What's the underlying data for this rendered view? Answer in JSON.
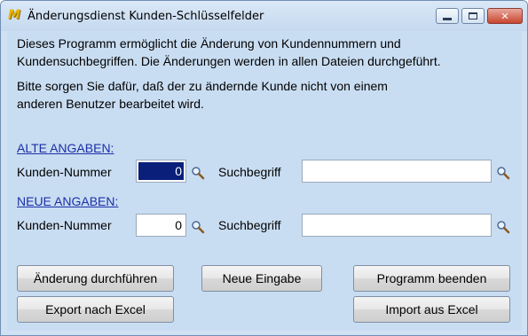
{
  "window": {
    "title": "Änderungsdienst Kunden-Schlüsselfelder",
    "app_icon_glyph": "M",
    "controls": {
      "minimize": "minimize",
      "maximize": "maximize",
      "close": "✕"
    }
  },
  "intro": {
    "line1": "Dieses Programm ermöglicht die Änderung von Kundennummern und",
    "line2": "Kundensuchbegriffen. Die Änderungen werden in allen Dateien durchgeführt.",
    "line3": "Bitte sorgen Sie dafür, daß der zu ändernde Kunde nicht von einem",
    "line4": "anderen Benutzer bearbeitet wird."
  },
  "old": {
    "heading": "ALTE ANGABEN:",
    "customer_number_label": "Kunden-Nummer",
    "customer_number_value": "0",
    "search_term_label": "Suchbegriff",
    "search_term_value": ""
  },
  "new": {
    "heading": "NEUE ANGABEN:",
    "customer_number_label": "Kunden-Nummer",
    "customer_number_value": "0",
    "search_term_label": "Suchbegriff",
    "search_term_value": ""
  },
  "buttons": {
    "apply": "Änderung durchführen",
    "new_entry": "Neue Eingabe",
    "exit": "Programm beenden",
    "export_excel": "Export nach Excel",
    "import_excel": "Import aus Excel"
  },
  "icons": {
    "app": "m-logo-icon",
    "lookup": "magnifier-icon"
  },
  "colors": {
    "window_bg": "#c9ddf2",
    "heading_link": "#1b2fa8",
    "selection": "#0a1f7a",
    "close_button": "#c8452f"
  }
}
